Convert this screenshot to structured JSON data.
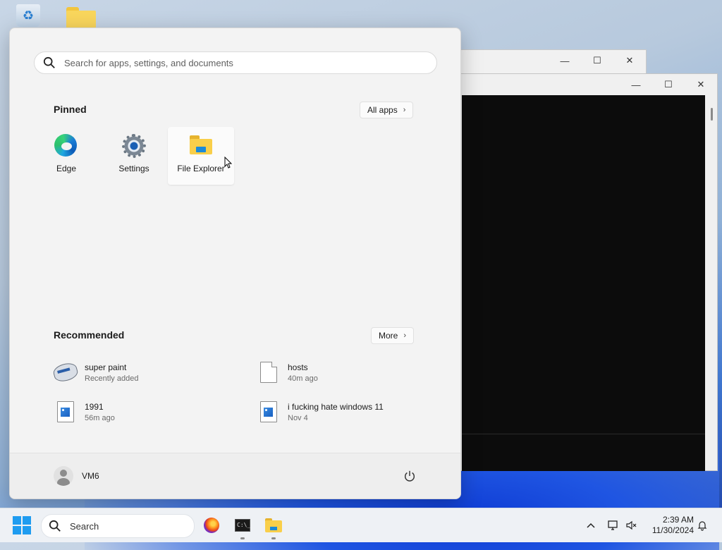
{
  "start_menu": {
    "search_placeholder": "Search for apps, settings, and documents",
    "pinned_title": "Pinned",
    "all_apps_label": "All apps",
    "pinned": [
      {
        "label": "Edge"
      },
      {
        "label": "Settings"
      },
      {
        "label": "File Explorer"
      }
    ],
    "recommended_title": "Recommended",
    "more_label": "More",
    "recommended": [
      {
        "name": "super paint",
        "sub": "Recently added",
        "icon": "paint-app-icon"
      },
      {
        "name": "hosts",
        "sub": "40m ago",
        "icon": "document-icon"
      },
      {
        "name": "1991",
        "sub": "56m ago",
        "icon": "image-file-icon"
      },
      {
        "name": "i fucking hate windows 11",
        "sub": "Nov 4",
        "icon": "image-file-icon"
      }
    ],
    "user_name": "VM6"
  },
  "taskbar": {
    "search_label": "Search",
    "time": "2:39 AM",
    "date": "11/30/2024",
    "apps": [
      "firefox-icon",
      "terminal-icon",
      "file-explorer-icon"
    ]
  },
  "window_controls": {
    "minimize": "—",
    "maximize": "☐",
    "close": "✕"
  }
}
